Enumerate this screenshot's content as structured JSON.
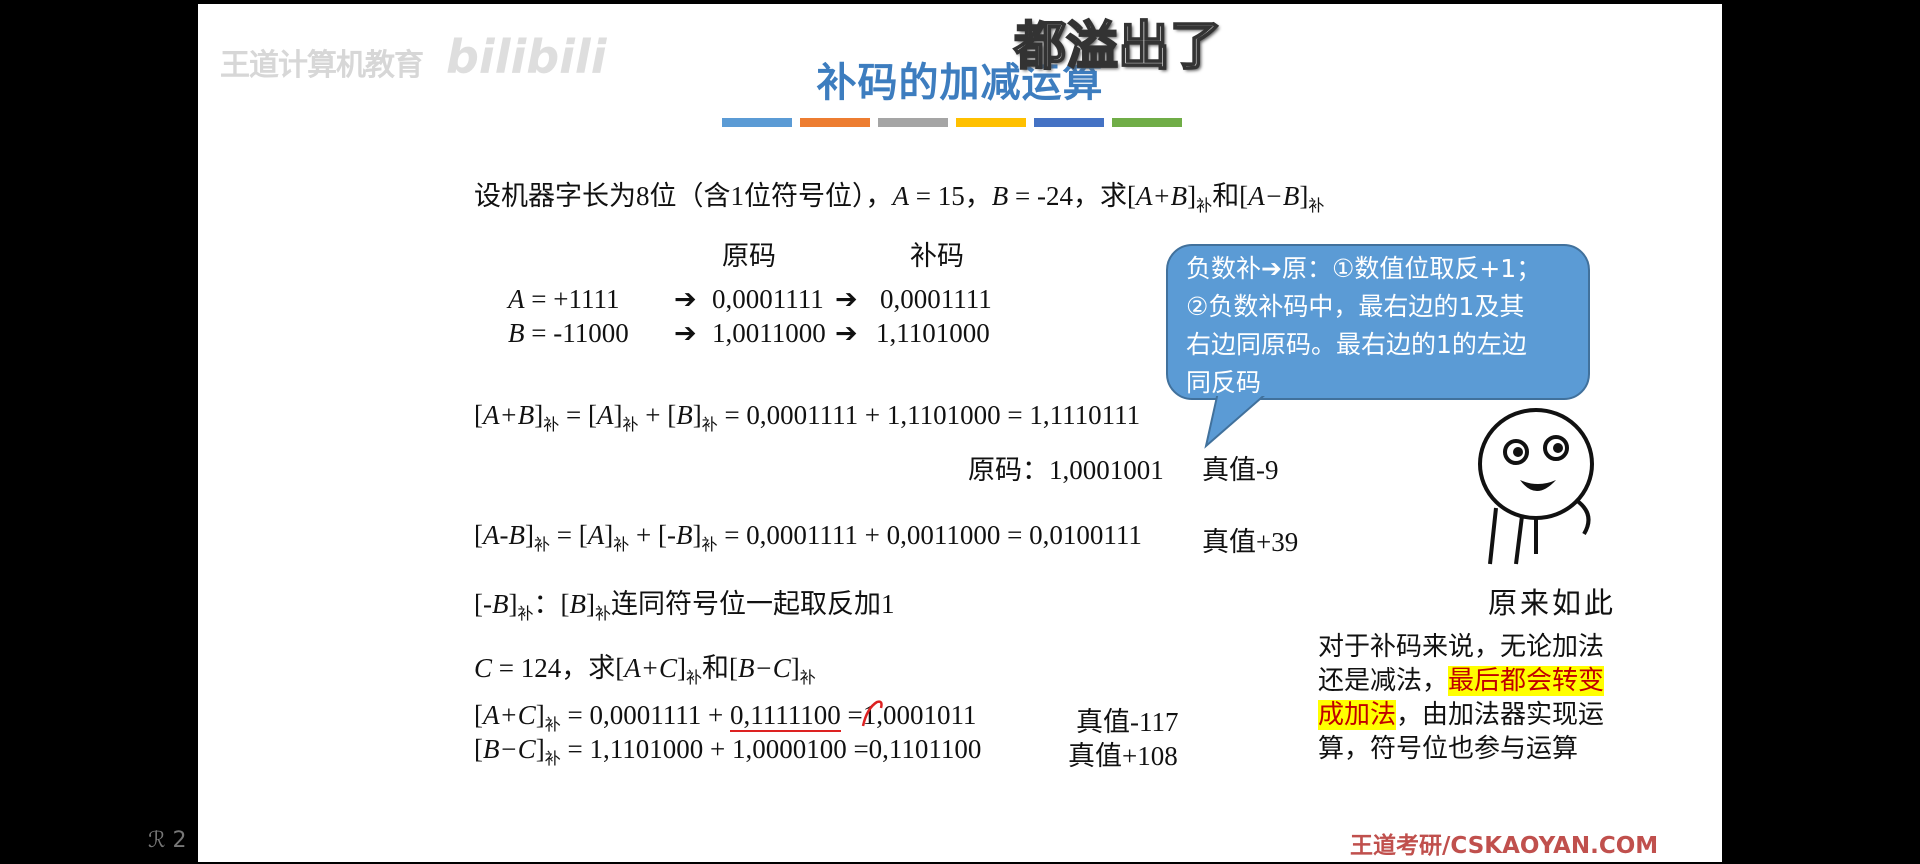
{
  "overlay": {
    "watermark": "王道计算机教育",
    "bili_logo": "bilibili",
    "caption": "都溢出了",
    "side_badge": "ℛ 2"
  },
  "slide": {
    "title": "补码的加减运算",
    "title_bar_colors": [
      "#5b9bd5",
      "#ed7d31",
      "#a5a5a5",
      "#ffc000",
      "#4472c4",
      "#70ad47"
    ],
    "problem": {
      "prefix": "设机器字长为8位（含1位符号位），",
      "a_eq": "A",
      "a_val": " = 15，",
      "b_eq": "B",
      "b_val": " = -24，求[",
      "q1": "A+B",
      "q1_close": "]",
      "q1_sub": "补",
      "mid": "和[",
      "q2": "A−B",
      "q2_close": "]",
      "q2_sub": "补"
    },
    "headers": {
      "yuanma": "原码",
      "buma": "补码"
    },
    "row_a": {
      "var": "A",
      "val": " = +1111",
      "arrow1": "➔",
      "orig": "0,0001111",
      "arrow2": "➔",
      "comp": "0,0001111"
    },
    "row_b": {
      "var": "B",
      "val": " = -11000",
      "arrow1": "➔",
      "orig": "1,0011000",
      "arrow2": "➔",
      "comp": "1,1101000"
    },
    "sum_ab": {
      "lhs": "A+B",
      "sub": "补",
      "rhs_a": "A",
      "rhs_b": "B",
      "calc": " = 0,0001111 + 1,1101000 = 1,1110111",
      "orig_label": "原码：1,0001001",
      "true_val": "真值-9"
    },
    "diff_ab": {
      "lhs": "A-B",
      "sub": "补",
      "rhs_a": "A",
      "rhs_b": "-B",
      "calc": " = 0,0001111 + 0,0011000 = 0,0100111",
      "true_val": "真值+39"
    },
    "neg_b": {
      "lhs": "-B",
      "sub": "补",
      "colon": "：",
      "rhs": "B",
      "desc": "连同符号位一起取反加1"
    },
    "c_problem": {
      "var": "C",
      "val": " = 124，求[",
      "q1": "A+C",
      "mid": "和[",
      "q2": "B−C",
      "sub": "补"
    },
    "sum_ac": {
      "lhs": "A+C",
      "sub": "补",
      "part1": " = 0,0001111 + ",
      "underlined": "0,1111100",
      "part2": " =",
      "struck": "1",
      "part3": ",0001011",
      "true_val": "真值-117"
    },
    "diff_bc": {
      "lhs": "B−C",
      "sub": "补",
      "calc": " = 1,1101000 + 1,0000100 =0,1101100",
      "true_val": "真值+108"
    },
    "callout": {
      "line1": "负数补➔原：①数值位取反+1；",
      "line2": "②负数补码中，最右边的1及其",
      "line3": "右边同原码。最右边的1的左边",
      "line4": "同反码"
    },
    "face_label": "原来如此",
    "note": {
      "line1": "对于补码来说，无论加法",
      "line2a": "还是减法，",
      "line2b": "最后都会转变",
      "line3a": "成加法",
      "line3b": "，由加法器实现运",
      "line4": "算，符号位也参与运算"
    },
    "footer": "王道考研/CSKAOYAN.COM"
  }
}
